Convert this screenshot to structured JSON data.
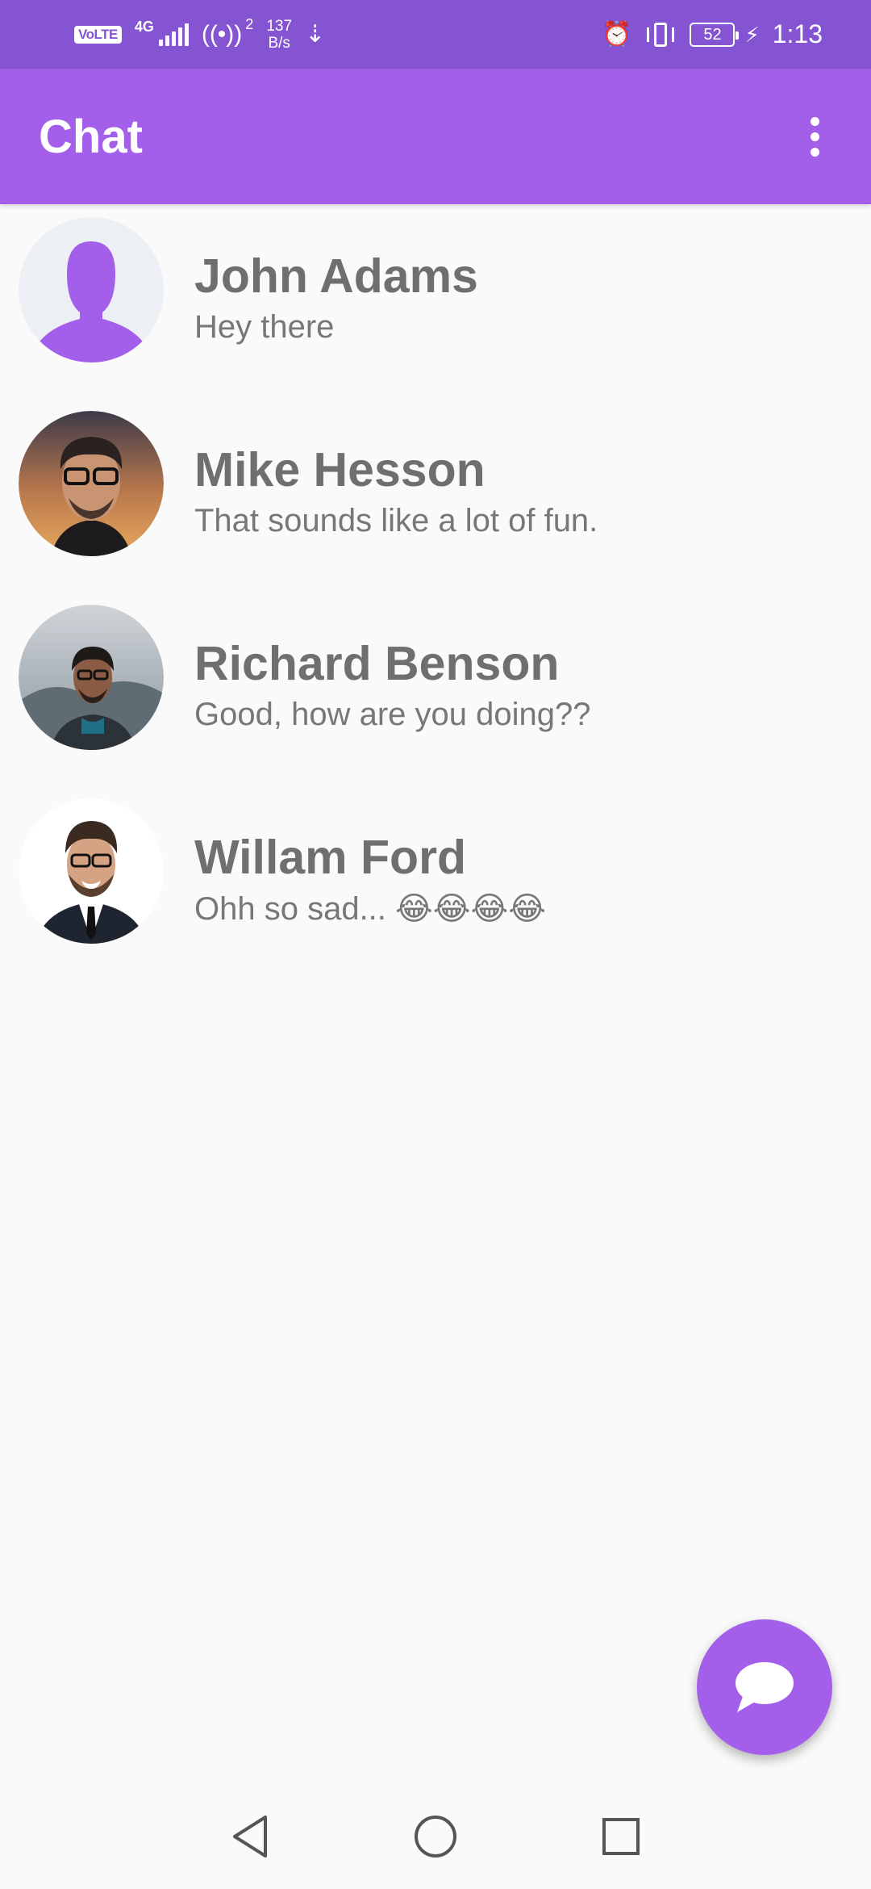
{
  "status_bar": {
    "volte": "VoLTE",
    "network": "4G",
    "hotspot_count": "2",
    "speed_value": "137",
    "speed_unit": "B/s",
    "battery": "52",
    "time": "1:13"
  },
  "app_bar": {
    "title": "Chat"
  },
  "chats": [
    {
      "name": "John Adams",
      "message": "Hey there"
    },
    {
      "name": "Mike Hesson",
      "message": "That sounds like a lot of fun."
    },
    {
      "name": "Richard Benson",
      "message": "Good, how are you doing??"
    },
    {
      "name": "Willam Ford",
      "message": "Ohh so sad... 😂😂😂😂"
    }
  ],
  "icons": {
    "fab": "chat-bubble-icon",
    "nav_back": "back-triangle-icon",
    "nav_home": "home-circle-icon",
    "nav_recent": "recent-square-icon"
  },
  "colors": {
    "status_bar": "#8554d2",
    "app_bar": "#a35fea",
    "accent": "#a35fea"
  }
}
